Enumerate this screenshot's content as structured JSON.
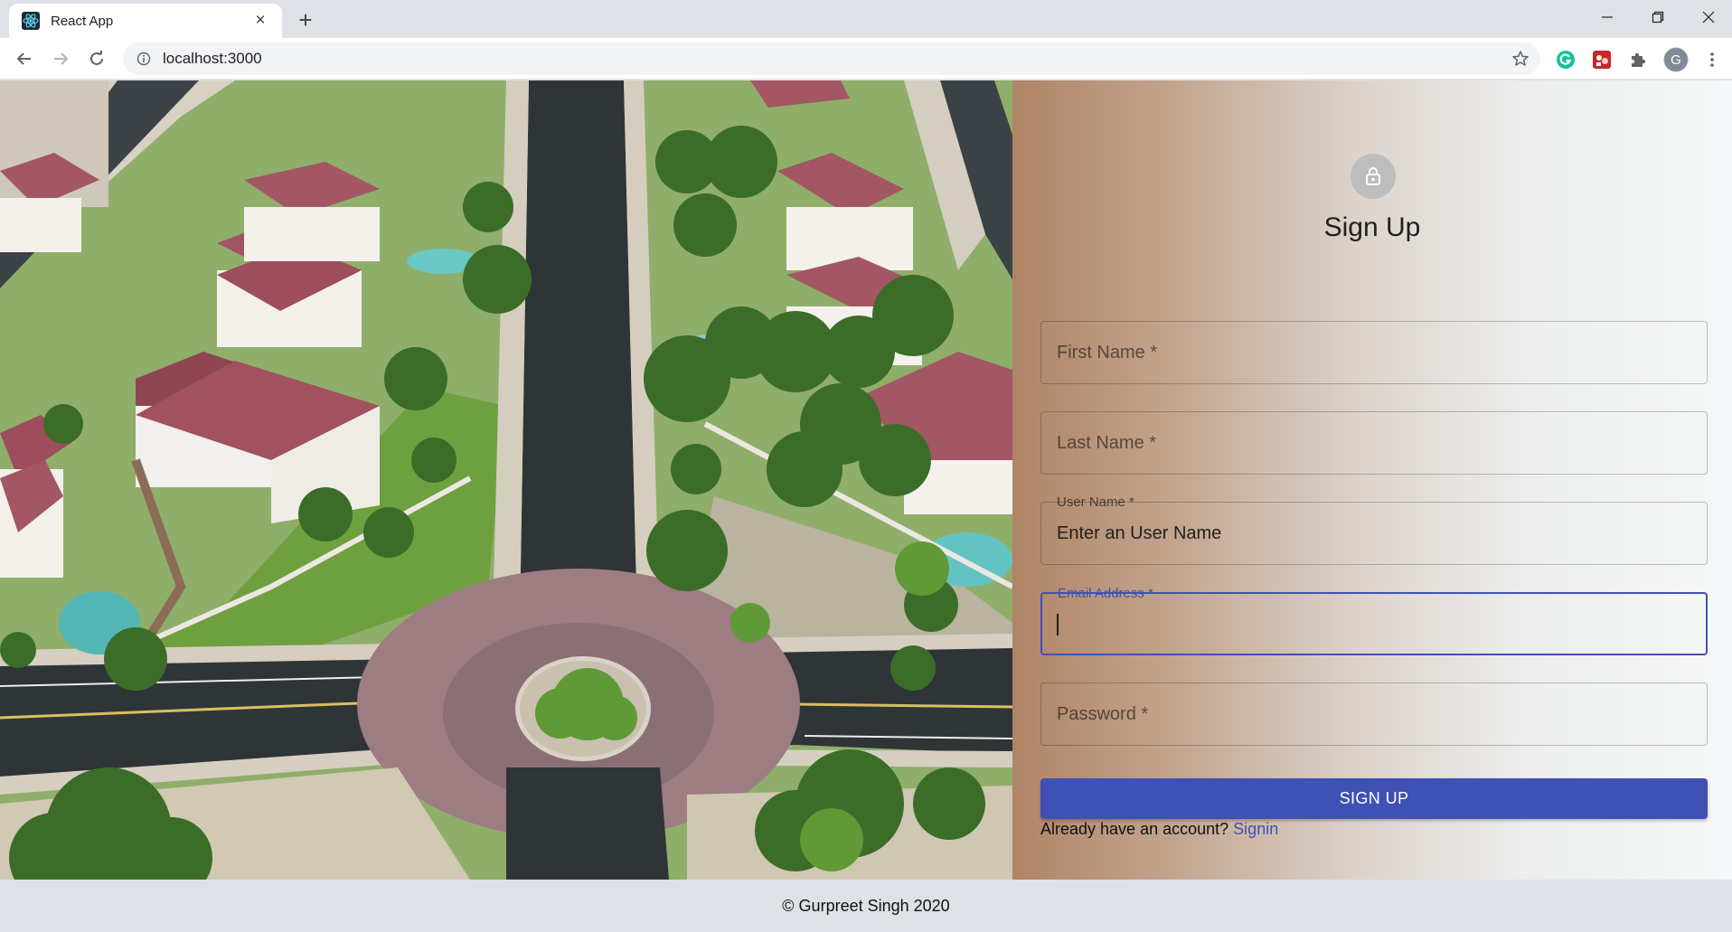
{
  "browser": {
    "tab_title": "React App",
    "url": "localhost:3000",
    "profile_initial": "G"
  },
  "signup": {
    "title": "Sign Up",
    "fields": {
      "first_name": {
        "label": "First Name *",
        "value": ""
      },
      "last_name": {
        "label": "Last Name *",
        "value": ""
      },
      "user_name": {
        "label": "User Name *",
        "value": "Enter an User Name"
      },
      "email": {
        "label": "Email Address *",
        "value": ""
      },
      "password": {
        "label": "Password *",
        "value": ""
      }
    },
    "submit_label": "SIGN UP",
    "signin_prompt": "Already have an account?",
    "signin_link": "Signin"
  },
  "footer": {
    "copyright": "© Gurpreet Singh 2020"
  },
  "colors": {
    "primary": "#3f51b5",
    "avatar_bg": "#bdbdbd",
    "panel_start": "#b08466",
    "panel_end": "#f5f7f8"
  },
  "icons": [
    "react-icon",
    "close-icon",
    "plus-icon",
    "minimize-icon",
    "restore-icon",
    "back-icon",
    "forward-icon",
    "reload-icon",
    "info-icon",
    "star-icon",
    "grammarly-icon",
    "extension-icon",
    "puzzle-icon",
    "menu-icon",
    "lock-icon"
  ]
}
